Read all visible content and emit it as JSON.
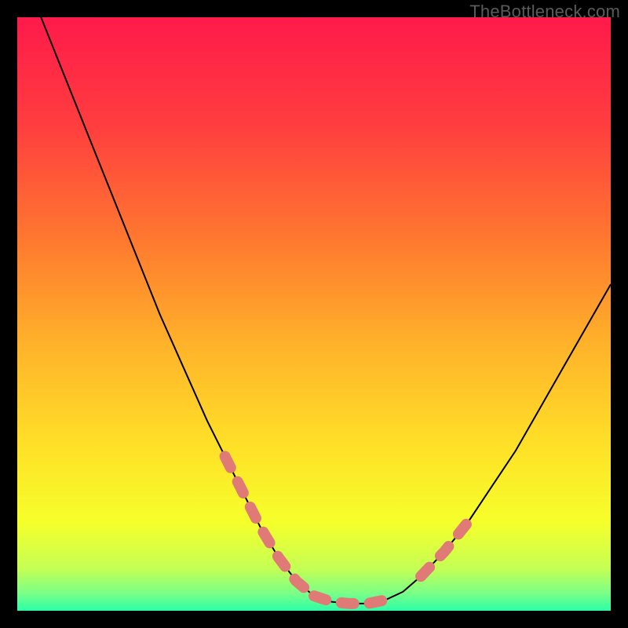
{
  "watermark": "TheBottleneck.com",
  "chart_data": {
    "type": "line",
    "title": "",
    "xlabel": "",
    "ylabel": "",
    "xlim": [
      0,
      100
    ],
    "ylim": [
      0,
      100
    ],
    "grid": false,
    "series": [
      {
        "name": "curve",
        "color": "#000000",
        "x": [
          4,
          8,
          12,
          16,
          20,
          24,
          28,
          32,
          35,
          38,
          41,
          44,
          47,
          50,
          53,
          56,
          59,
          62,
          65,
          68,
          72,
          76,
          80,
          84,
          88,
          92,
          96,
          100
        ],
        "y": [
          100,
          90,
          80,
          70,
          60,
          50,
          41,
          32,
          26,
          20,
          14,
          9,
          5,
          2.5,
          1.5,
          1.2,
          1.2,
          1.8,
          3.2,
          5.8,
          10,
          15,
          21,
          27,
          34,
          41,
          48,
          55
        ]
      },
      {
        "name": "highlighted-segment-left",
        "color": "#e07a76",
        "style": "dashed-thick",
        "x": [
          35,
          38,
          41,
          44,
          47,
          50
        ],
        "y": [
          26,
          20,
          14,
          9,
          5,
          2.5
        ]
      },
      {
        "name": "highlighted-segment-bottom",
        "color": "#e07a76",
        "style": "dashed-thick",
        "x": [
          50,
          53,
          56,
          59,
          62
        ],
        "y": [
          2.5,
          1.5,
          1.2,
          1.2,
          1.8
        ]
      },
      {
        "name": "highlighted-segment-right",
        "color": "#e07a76",
        "style": "dashed-thick",
        "x": [
          68,
          72,
          76
        ],
        "y": [
          5.8,
          10,
          15
        ]
      }
    ],
    "background_gradient": {
      "type": "vertical",
      "stops": [
        {
          "offset": 0.0,
          "color": "#ff1a4a"
        },
        {
          "offset": 0.18,
          "color": "#ff3d3f"
        },
        {
          "offset": 0.38,
          "color": "#ff7a2f"
        },
        {
          "offset": 0.55,
          "color": "#ffb22a"
        },
        {
          "offset": 0.72,
          "color": "#ffe028"
        },
        {
          "offset": 0.85,
          "color": "#f6ff2a"
        },
        {
          "offset": 0.93,
          "color": "#c4ff55"
        },
        {
          "offset": 0.97,
          "color": "#7bff87"
        },
        {
          "offset": 1.0,
          "color": "#2bffa8"
        }
      ]
    }
  }
}
